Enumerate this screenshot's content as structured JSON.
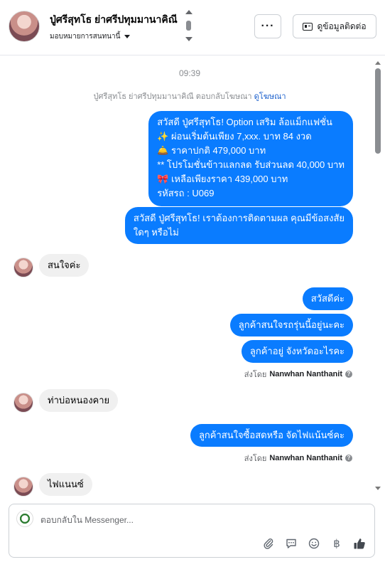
{
  "header": {
    "contact_name": "ปู่ศรีสุทโธ ย่าศรีปทุมมานาคิณี",
    "assign_label": "มอบหมายการสนทนานี้",
    "more_label": "···",
    "info_label": "ดูข้อมูลติดต่อ"
  },
  "conversation": {
    "timestamp": "09:39",
    "ad_reply_text": "ปู่ศรีสุทโธ ย่าศรีปทุมมานาคิณี ตอบกลับโฆษณา",
    "ad_link": "ดูโฆษณา",
    "messages": {
      "out1": {
        "line1": "สวัสดี ปู่ศรีสุทโธ! Option เสริม ล้อแม็กแฟชั่น",
        "line2": "✨  ผ่อนเริ่มต้นเพียง 7,xxx. บาท 84 งวด",
        "line3": "🛎️ ราคาปกติ 479,000 บาท",
        "line4": "** โปรโมชั่นข้าวแลกลด รับส่วนลด 40,000 บาท",
        "line5": "🎀  เหลือเพียงราคา 439,000 บาท",
        "line6": " รหัสรถ : U069"
      },
      "out2": {
        "line1": "สวัสดี ปู่ศรีสุทโธ! เราต้องการติดตามผล คุณมีข้อสงสัย",
        "line2": "ใดๆ หรือไม่"
      },
      "in1": "สนใจค่ะ",
      "out3": "สวัสดีค่ะ",
      "out4": "ลูกค้าสนใจรถรุ่นนี้อยู่นะคะ",
      "out5": "ลูกค้าอยู่ จังหวัดอะไรคะ",
      "sent_by_1": {
        "prefix": "ส่งโดย",
        "name": "Nanwhan Nanthanit"
      },
      "in2": "ท่าบ่อหนองคาย",
      "out6": "ลูกค้าสนใจซื้อสดหรือ จัดไฟแน้นซ์คะ",
      "sent_by_2": {
        "prefix": "ส่งโดย",
        "name": "Nanwhan Nanthanit"
      },
      "in3": "ไฟแนนซ์"
    }
  },
  "composer": {
    "placeholder": "ตอบกลับใน Messenger...",
    "icons": [
      "paperclip-icon",
      "saved-replies-icon",
      "emoji-icon",
      "baht-icon",
      "thumbs-up-icon"
    ]
  },
  "colors": {
    "outgoing_bubble": "#0a7cff",
    "incoming_bubble": "#f0f0f0",
    "link": "#1a5fcc"
  }
}
